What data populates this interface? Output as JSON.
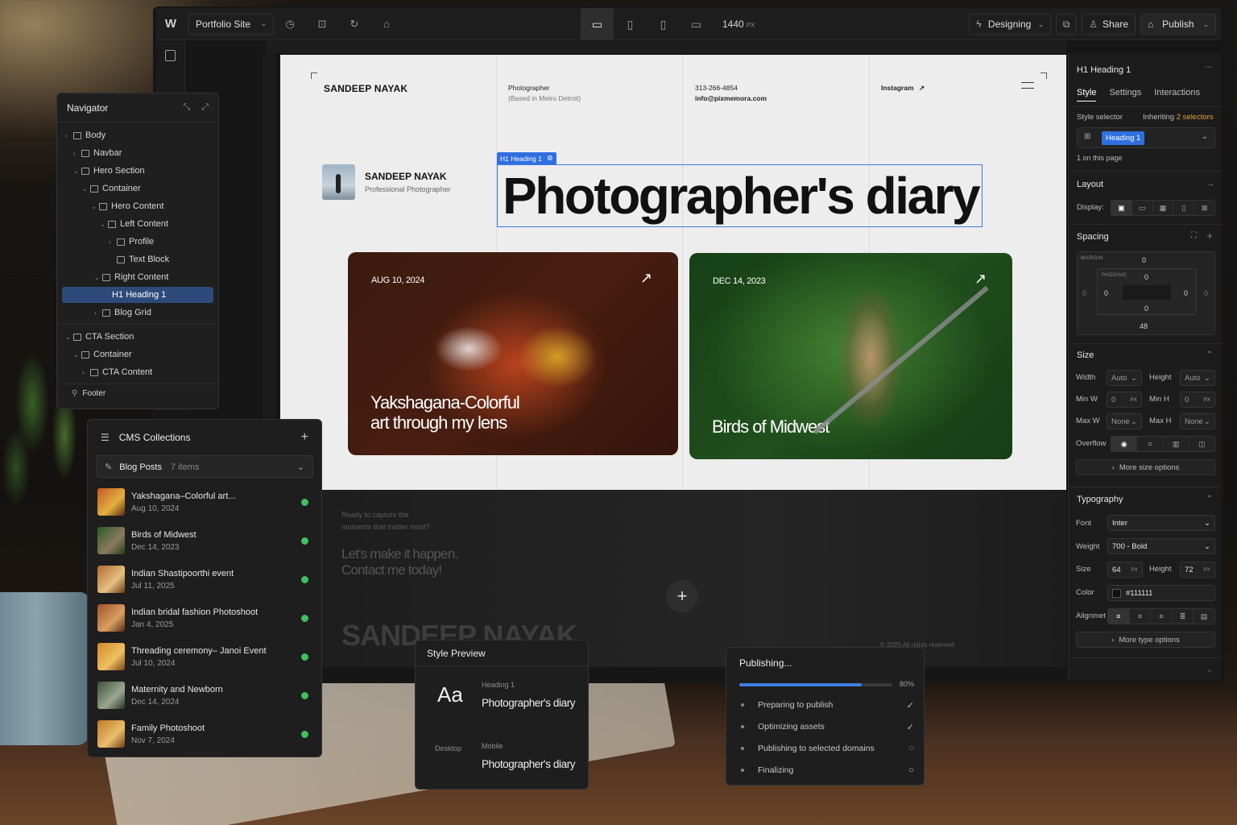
{
  "topbar": {
    "site_name": "Portfolio Site",
    "width_value": "1440",
    "width_unit": "PX",
    "mode_label": "Designing",
    "share_label": "Share",
    "publish_label": "Publish"
  },
  "navigator": {
    "title": "Navigator",
    "items": [
      {
        "label": "Body"
      },
      {
        "label": "Navbar"
      },
      {
        "label": "Hero Section"
      },
      {
        "label": "Container"
      },
      {
        "label": "Hero Content"
      },
      {
        "label": "Left Content"
      },
      {
        "label": "Profile"
      },
      {
        "label": "Text Block"
      },
      {
        "label": "Right Content"
      },
      {
        "label": "H1  Heading 1",
        "selected": true
      },
      {
        "label": "Blog Grid"
      },
      {
        "label": "CTA Section"
      },
      {
        "label": "Container"
      },
      {
        "label": "CTA Content"
      },
      {
        "label": "Footer"
      }
    ]
  },
  "canvas": {
    "brand": "SANDEEP NAYAK",
    "col1_line1": "Photographer",
    "col1_line2": "(Based in Metro Detroit)",
    "col2_line1": "313-266-4854",
    "col2_line2": "info@pixmemora.com",
    "col3_line1": "Instagram",
    "profile_name": "SANDEEP NAYAK",
    "profile_title": "Professional Photographer",
    "selection_tag": "H1 Heading 1",
    "heading": "Photographer's diary",
    "cards": [
      {
        "date": "AUG 10, 2024",
        "title_line1": "Yakshagana-Colorful",
        "title_line2": "art through my lens"
      },
      {
        "date": "DEC 14, 2023",
        "title_line1": "Birds of Midwest",
        "title_line2": ""
      }
    ],
    "cta_q_line1": "Ready to capture the",
    "cta_q_line2": "moments that matter most?",
    "cta_line1": "Let's make it happen.",
    "cta_line2": "Contact me today!",
    "cta_brand": "SANDEEP NAYAK",
    "copyright": "© 2025 All rights reserved"
  },
  "cms": {
    "title": "CMS Collections",
    "collection": "Blog Posts",
    "count": "7 items",
    "items": [
      {
        "title": "Yakshagana–Colorful art...",
        "date": "Aug 10, 2024"
      },
      {
        "title": "Birds of Midwest",
        "date": "Dec 14, 2023"
      },
      {
        "title": "Indian Shastipoorthi event",
        "date": "Jul 11, 2025"
      },
      {
        "title": "Indian bridal fashion Photoshoot",
        "date": "Jan 4, 2025"
      },
      {
        "title": "Threading ceremony– Janoi Event",
        "date": "Jul 10, 2024"
      },
      {
        "title": "Maternity and Newborn",
        "date": "Dec 14, 2024"
      },
      {
        "title": "Family Photoshoot",
        "date": "Nov 7, 2024"
      }
    ],
    "status_color": "#3fbf60"
  },
  "style_preview": {
    "title": "Style Preview",
    "sample": "Aa",
    "heading_label": "Heading 1",
    "heading_value": "Photographer's diary",
    "desktop_label": "Desktop",
    "mobile_label": "Mobile",
    "mobile_value": "Photographer's diary"
  },
  "publishing": {
    "title": "Publishing...",
    "progress": 0.8,
    "progress_label": "80%",
    "steps": [
      {
        "label": "Preparing to publish",
        "status": "✓"
      },
      {
        "label": "Optimizing assets",
        "status": "✓"
      },
      {
        "label": "Publishing to selected domains",
        "status": "◌"
      },
      {
        "label": "Finalizing",
        "status": "○"
      }
    ],
    "accent": "#3e7fe0"
  },
  "right_panel": {
    "element_title": "H1  Heading 1",
    "tabs": [
      "Style",
      "Settings",
      "Interactions"
    ],
    "style_selector_label": "Style selector",
    "inheriting_prefix": "Inheriting",
    "inheriting_count": "2 selectors",
    "selector_chip": "Heading 1",
    "on_page": "1 on this page",
    "layout": {
      "title": "Layout",
      "display_label": "Display:"
    },
    "spacing": {
      "title": "Spacing",
      "margin_label": "MARGIN",
      "padding_label": "PADDING",
      "margin_top": "0",
      "margin_left": "0",
      "margin_right": "0",
      "margin_bottom": "48",
      "padding_top": "0",
      "padding_left": "0",
      "padding_right": "0",
      "padding_bottom": "0"
    },
    "size": {
      "title": "Size",
      "width_label": "Width",
      "width_value": "Auto",
      "height_label": "Height",
      "height_value": "Auto",
      "minw_label": "Min W",
      "minw_value": "0",
      "minw_unit": "PX",
      "minh_label": "Min H",
      "minh_value": "0",
      "minh_unit": "PX",
      "maxw_label": "Max W",
      "maxw_value": "None",
      "maxh_label": "Max H",
      "maxh_value": "None",
      "overflow_label": "Overflow",
      "more_label": "More size options"
    },
    "typography": {
      "title": "Typography",
      "font_label": "Font",
      "font_value": "Inter",
      "weight_label": "Weight",
      "weight_value": "700 - Bold",
      "size_label": "Size",
      "size_value": "64",
      "size_unit": "PX",
      "lh_label": "Height",
      "lh_value": "72",
      "lh_unit": "PX",
      "color_label": "Color",
      "color_value": "#111111",
      "align_label": "Alignmet",
      "more_label": "More type options"
    }
  }
}
